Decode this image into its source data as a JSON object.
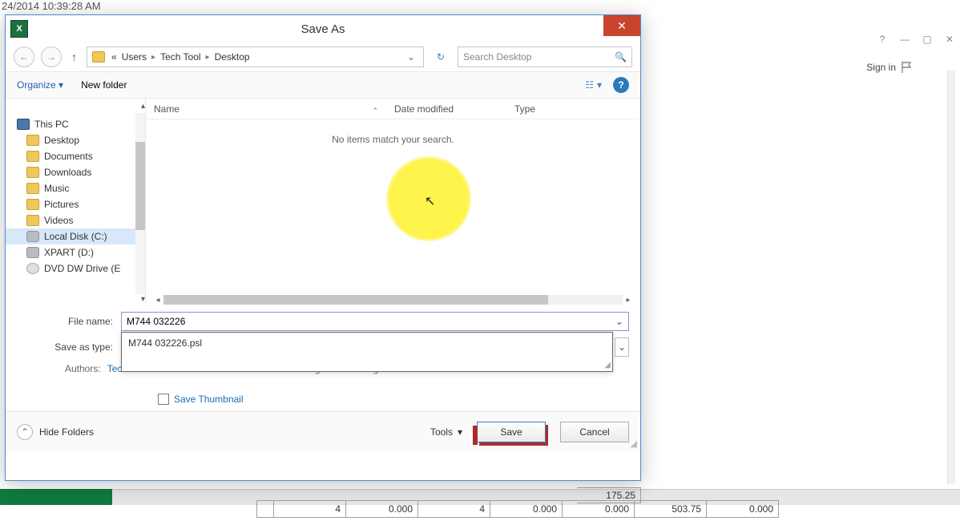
{
  "timestamp": "24/2014 10:39:28 AM",
  "excel": {
    "signin": "Sign in",
    "cells": [
      "",
      "4",
      "0.000",
      "4",
      "0.000",
      "0.000",
      "503.75",
      "0.000"
    ],
    "cell_above": "175.25"
  },
  "dialog": {
    "title": "Save As",
    "breadcrumb": {
      "prefix": "«",
      "items": [
        "Users",
        "Tech Tool",
        "Desktop"
      ]
    },
    "search_placeholder": "Search Desktop",
    "toolbar": {
      "organize": "Organize",
      "newfolder": "New folder"
    },
    "nav": {
      "root": "This PC",
      "items": [
        "Desktop",
        "Documents",
        "Downloads",
        "Music",
        "Pictures",
        "Videos",
        "Local Disk (C:)",
        "XPART (D:)",
        "DVD DW Drive (E"
      ]
    },
    "columns": {
      "name": "Name",
      "date": "Date modified",
      "type": "Type"
    },
    "empty": "No items match your search.",
    "filename_label": "File name:",
    "filename_value": "M744 032226",
    "saveas_label": "Save as type:",
    "autocomplete": "M744 032226.psl",
    "authors_label": "Authors:",
    "authors_value": "Tech Tool",
    "tags_label": "Tags:",
    "tags_value": "Add a tag",
    "save_thumbnail": "Save Thumbnail",
    "hide_folders": "Hide Folders",
    "tools": "Tools",
    "save": "Save",
    "cancel": "Cancel"
  }
}
